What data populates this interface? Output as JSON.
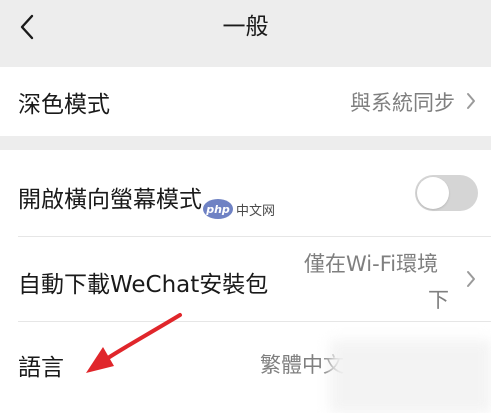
{
  "nav": {
    "title": "一般",
    "back_icon": "chevron-left-icon"
  },
  "settings": {
    "dark_mode": {
      "label": "深色模式",
      "value": "與系統同步"
    },
    "landscape": {
      "label": "開啟橫向螢幕模式",
      "enabled": false
    },
    "auto_download": {
      "label": "自動下載WeChat安裝包",
      "value_line1": "僅在Wi-Fi環境",
      "value_line2": "下"
    },
    "language": {
      "label": "語言",
      "value": "繁體中文"
    }
  },
  "watermark": {
    "logo": "php",
    "text": "中文网"
  },
  "annotation": {
    "arrow_color": "#e0262b"
  },
  "colors": {
    "background": "#ededed",
    "row_bg": "#ffffff",
    "secondary_text": "#7f7f7f",
    "toggle_off": "#d5d5d5"
  }
}
